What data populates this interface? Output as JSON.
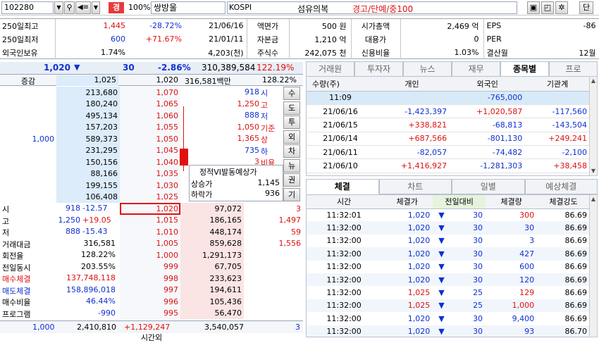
{
  "toolbar": {
    "code": "102280",
    "warn": "경",
    "pct": "100%",
    "name": "쌍방울",
    "market": "KOSPI",
    "sector": "섬유의복",
    "alert": "경고/단예/중100",
    "short_btn": "단"
  },
  "info": {
    "rows": [
      {
        "l1": "250일최고",
        "v1": "1,445",
        "p1": "-28.72%",
        "d1": "21/06/16",
        "l2": "액면가",
        "v2": "500 원",
        "l3": "시가총액",
        "v3": "2,469 억",
        "l4": "EPS",
        "v4": "-86"
      },
      {
        "l1": "250일최저",
        "v1": "600",
        "p1": "+71.67%",
        "d1": "21/01/11",
        "l2": "자본금",
        "v2": "1,210 억",
        "l3": "대용가",
        "v3": "0",
        "l4": "PER",
        "v4": ""
      },
      {
        "l1": "외국인보유",
        "v1": "1.74%",
        "p1": "",
        "d1": "4,203(천)",
        "l2": "주식수",
        "v2": "242,075 천",
        "l3": "신용비율",
        "v3": "1.03%",
        "l4": "결산월",
        "v4": "12월"
      }
    ]
  },
  "quote": {
    "price": "1,020",
    "change": "30",
    "rate": "-2.86%",
    "volume": "310,389,584",
    "vol_rate": "122.19%",
    "h_label": "증감",
    "h_ask": "1,025",
    "h_price": "1,020",
    "h_vol": "316,581백만",
    "h_vrate": "128.22%"
  },
  "asks": [
    {
      "qty": "213,680",
      "price": "1,070"
    },
    {
      "qty": "180,240",
      "price": "1,065"
    },
    {
      "qty": "495,134",
      "price": "1,060"
    },
    {
      "qty": "157,203",
      "price": "1,055"
    },
    {
      "qty": "589,373",
      "price": "1,050",
      "chg": "1,000"
    },
    {
      "qty": "231,295",
      "price": "1,045"
    },
    {
      "qty": "150,156",
      "price": "1,040"
    },
    {
      "qty": "88,166",
      "price": "1,035"
    },
    {
      "qty": "199,155",
      "price": "1,030"
    },
    {
      "qty": "106,408",
      "price": "1,025"
    }
  ],
  "bids": [
    {
      "price": "1,020",
      "qty": "97,072",
      "chg": "3"
    },
    {
      "price": "1,015",
      "qty": "186,165",
      "chg": "1,497"
    },
    {
      "price": "1,010",
      "qty": "448,174",
      "chg": "59"
    },
    {
      "price": "1,005",
      "qty": "859,628",
      "chg": "1,556"
    },
    {
      "price": "1,000",
      "qty": "1,291,173",
      "chg": ""
    },
    {
      "price": "999",
      "qty": "67,705",
      "chg": ""
    },
    {
      "price": "998",
      "qty": "233,623",
      "chg": ""
    },
    {
      "price": "997",
      "qty": "194,611",
      "chg": ""
    },
    {
      "price": "996",
      "qty": "105,436",
      "chg": ""
    },
    {
      "price": "995",
      "qty": "56,470",
      "chg": ""
    }
  ],
  "ohlc": [
    {
      "v": "918",
      "l": "시"
    },
    {
      "v": "1,250",
      "l": "고"
    },
    {
      "v": "888",
      "l": "저"
    },
    {
      "v": "1,050",
      "l": "기준"
    },
    {
      "v": "1,365",
      "l": "상"
    },
    {
      "v": "735",
      "l": "하"
    },
    {
      "v": "3",
      "l": "비용"
    }
  ],
  "vtabs": [
    "수",
    "도",
    "투",
    "외",
    "차",
    "뉴",
    "권",
    "기"
  ],
  "expected": {
    "title": "정적VI발동예상가",
    "up_label": "상승가",
    "up": "1,145",
    "down_label": "하락가",
    "down": "936"
  },
  "stats": [
    {
      "l": "시",
      "a": "918",
      "b": "-12.57"
    },
    {
      "l": "고",
      "a": "1,250",
      "b": "+19.05"
    },
    {
      "l": "저",
      "a": "888",
      "b": "-15.43"
    },
    {
      "l": "거래대금",
      "a": "316,581",
      "b": ""
    },
    {
      "l": "회전율",
      "a": "128.22%",
      "b": ""
    },
    {
      "l": "전일동시",
      "a": "203.55%",
      "b": ""
    },
    {
      "l": "매수체결",
      "a": "137,748,118",
      "b": ""
    },
    {
      "l": "매도체결",
      "a": "158,896,018",
      "b": ""
    },
    {
      "l": "매수비율",
      "a": "46.44%",
      "b": ""
    },
    {
      "l": "프로그램",
      "a": "-990",
      "b": ""
    }
  ],
  "totals": {
    "left": "1,000",
    "ask": "2,410,810",
    "diff": "+1,129,247",
    "bid": "3,540,057",
    "chg": "3",
    "bottom": "시간외"
  },
  "flow_tabs": [
    "거래원",
    "투자자",
    "뉴스",
    "재무",
    "종목별",
    "프로"
  ],
  "flow": {
    "head": [
      "수량(주)",
      "개인",
      "외국인",
      "기관계"
    ],
    "rows": [
      {
        "date": "11:09",
        "a": "",
        "b": "-765,000",
        "c": ""
      },
      {
        "date": "21/06/16",
        "a": "-1,423,397",
        "b": "+1,020,587",
        "c": "-117,560"
      },
      {
        "date": "21/06/15",
        "a": "+338,821",
        "b": "-68,813",
        "c": "-143,504"
      },
      {
        "date": "21/06/14",
        "a": "+687,566",
        "b": "-801,130",
        "c": "+249,241"
      },
      {
        "date": "21/06/11",
        "a": "-82,057",
        "b": "-74,482",
        "c": "-2,100"
      },
      {
        "date": "21/06/10",
        "a": "+1,416,927",
        "b": "-1,281,303",
        "c": "+38,458"
      }
    ]
  },
  "trade_tabs": [
    "체결",
    "차트",
    "일별",
    "예상체결"
  ],
  "trade": {
    "head": [
      "시간",
      "체결가",
      "전일대비",
      "체결량",
      "체결강도"
    ],
    "rows": [
      {
        "t": "11:32:01",
        "p": "1,020",
        "d": "30",
        "q": "300",
        "s": "86.69",
        "qc": "red"
      },
      {
        "t": "11:32:00",
        "p": "1,020",
        "d": "30",
        "q": "30",
        "s": "86.69",
        "qc": "blue"
      },
      {
        "t": "11:32:00",
        "p": "1,020",
        "d": "30",
        "q": "3",
        "s": "86.69",
        "qc": "blue"
      },
      {
        "t": "11:32:00",
        "p": "1,020",
        "d": "30",
        "q": "427",
        "s": "86.69",
        "qc": "blue"
      },
      {
        "t": "11:32:00",
        "p": "1,020",
        "d": "30",
        "q": "600",
        "s": "86.69",
        "qc": "blue"
      },
      {
        "t": "11:32:00",
        "p": "1,020",
        "d": "30",
        "q": "120",
        "s": "86.69",
        "qc": "blue"
      },
      {
        "t": "11:32:00",
        "p": "1,025",
        "d": "25",
        "q": "129",
        "s": "86.69",
        "qc": "red"
      },
      {
        "t": "11:32:00",
        "p": "1,025",
        "d": "25",
        "q": "1,000",
        "s": "86.69",
        "qc": "red"
      },
      {
        "t": "11:32:00",
        "p": "1,020",
        "d": "30",
        "q": "9,400",
        "s": "86.69",
        "qc": "blue"
      },
      {
        "t": "11:32:00",
        "p": "1,020",
        "d": "30",
        "q": "93",
        "s": "86.70",
        "qc": "blue"
      },
      {
        "t": "11:31:59",
        "p": "1,020",
        "d": "30",
        "q": "100",
        "s": "86.70",
        "qc": "blue"
      }
    ]
  }
}
